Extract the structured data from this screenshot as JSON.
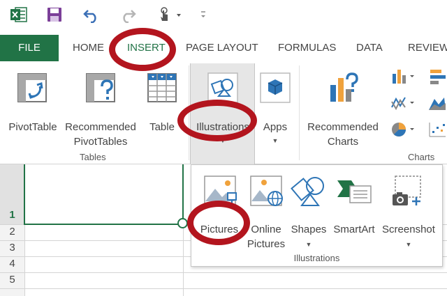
{
  "quick_access": {
    "items": [
      {
        "name": "excel-logo-icon"
      },
      {
        "name": "save-icon"
      },
      {
        "name": "undo-icon"
      },
      {
        "name": "redo-icon"
      },
      {
        "name": "touch-mode-icon"
      },
      {
        "name": "customize-toolbar-icon"
      }
    ]
  },
  "tabs": {
    "file": "FILE",
    "home": "HOME",
    "insert": "INSERT",
    "page_layout": "PAGE LAYOUT",
    "formulas": "FORMULAS",
    "data": "DATA",
    "review": "REVIEW"
  },
  "ribbon": {
    "pivottable": "PivotTable",
    "recommended_pivot_line1": "Recommended",
    "recommended_pivot_line2": "PivotTables",
    "table": "Table",
    "illustrations": "Illustrations",
    "apps": "Apps",
    "recommended_charts_line1": "Recommended",
    "recommended_charts_line2": "Charts",
    "group_tables": "Tables",
    "group_charts": "Charts"
  },
  "grid": {
    "rows": [
      "1",
      "2",
      "3",
      "4",
      "5"
    ]
  },
  "dropdown": {
    "pictures": "Pictures",
    "online_pictures_line1": "Online",
    "online_pictures_line2": "Pictures",
    "shapes": "Shapes",
    "smartart": "SmartArt",
    "screenshot": "Screenshot",
    "group_label": "Illustrations"
  },
  "colors": {
    "excel_green": "#217346",
    "annotation_red": "#b3151e",
    "selected_bg": "#e6e6e6"
  }
}
